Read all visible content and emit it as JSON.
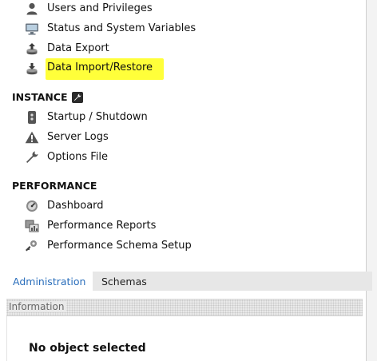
{
  "management": {
    "items": [
      {
        "label": "Users and Privileges",
        "icon": "user-icon"
      },
      {
        "label": "Status and System Variables",
        "icon": "monitor-icon"
      },
      {
        "label": "Data Export",
        "icon": "export-icon"
      },
      {
        "label": "Data Import/Restore",
        "icon": "import-icon",
        "highlighted": true
      }
    ]
  },
  "instance": {
    "title": "INSTANCE",
    "items": [
      {
        "label": "Startup / Shutdown",
        "icon": "server-power-icon"
      },
      {
        "label": "Server Logs",
        "icon": "warning-icon"
      },
      {
        "label": "Options File",
        "icon": "wrench-icon"
      }
    ]
  },
  "performance": {
    "title": "PERFORMANCE",
    "items": [
      {
        "label": "Dashboard",
        "icon": "dashboard-icon"
      },
      {
        "label": "Performance Reports",
        "icon": "reports-icon"
      },
      {
        "label": "Performance Schema Setup",
        "icon": "schema-setup-icon"
      }
    ]
  },
  "tabs": {
    "administration": "Administration",
    "schemas": "Schemas"
  },
  "information": {
    "header": "Information",
    "message": "No object selected"
  },
  "colors": {
    "highlight": "#ffff3a",
    "active_tab_text": "#2a6ebb"
  }
}
